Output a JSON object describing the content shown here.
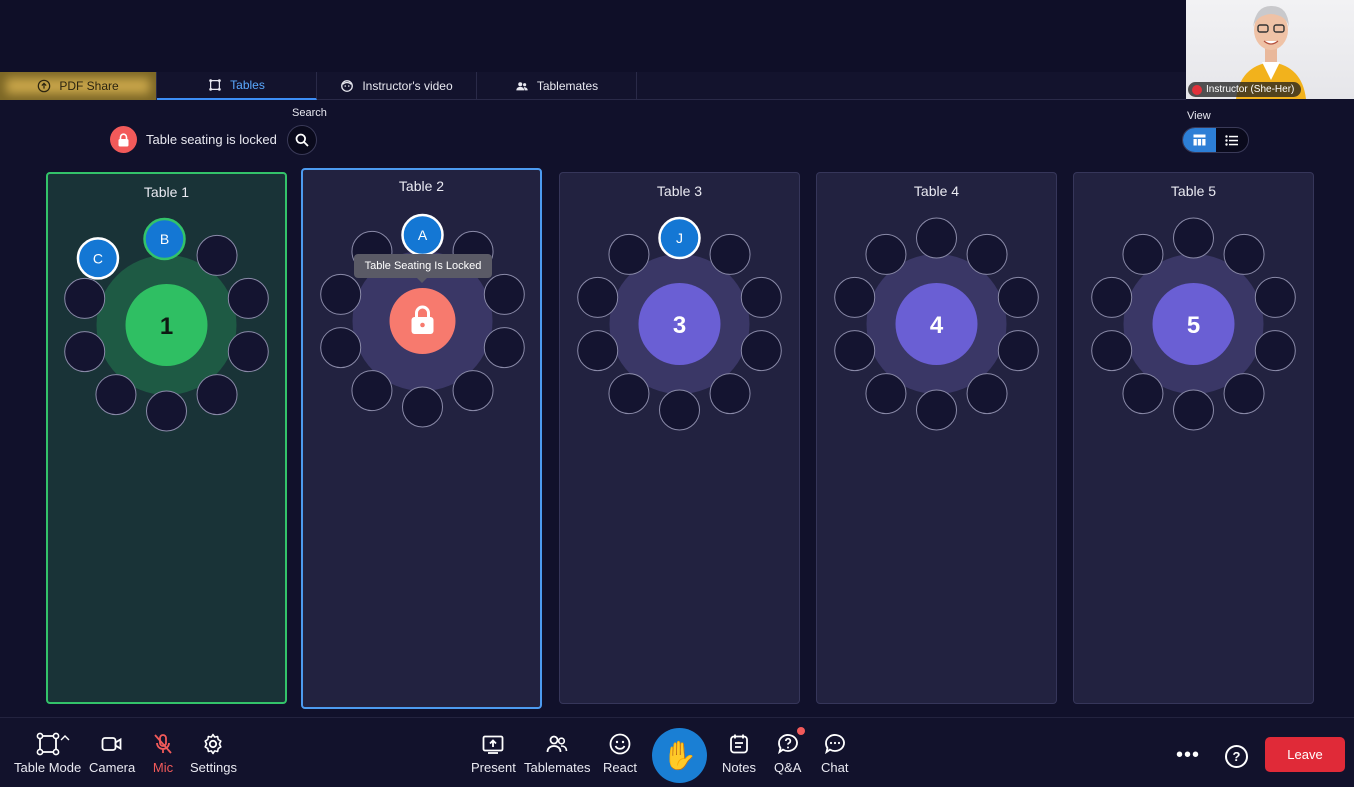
{
  "tabs": [
    {
      "label": "PDF Share",
      "icon": "share-screen-icon"
    },
    {
      "label": "Tables",
      "icon": "tables-icon"
    },
    {
      "label": "Instructor's video",
      "icon": "face-icon"
    },
    {
      "label": "Tablemates",
      "icon": "people-icon"
    }
  ],
  "instructor_video": {
    "label": "Instructor (She-Her)"
  },
  "status": {
    "lock_text": "Table seating is locked",
    "search_label": "Search",
    "view_label": "View"
  },
  "tooltip": "Table Seating Is Locked",
  "tables": [
    {
      "title": "Table 1",
      "number": "1",
      "seats_taken": [
        "C",
        "B"
      ]
    },
    {
      "title": "Table 2",
      "number": "",
      "seats_taken": [
        "A"
      ]
    },
    {
      "title": "Table 3",
      "number": "3",
      "seats_taken": [
        "J"
      ]
    },
    {
      "title": "Table 4",
      "number": "4",
      "seats_taken": []
    },
    {
      "title": "Table 5",
      "number": "5",
      "seats_taken": []
    }
  ],
  "toolbar": {
    "table_mode": "Table Mode",
    "camera": "Camera",
    "mic": "Mic",
    "settings": "Settings",
    "present": "Present",
    "tablemates": "Tablemates",
    "react": "React",
    "notes": "Notes",
    "qa": "Q&A",
    "chat": "Chat",
    "more": "•••",
    "help": "?",
    "leave": "Leave"
  },
  "colors": {
    "accent": "#2d7fd6",
    "green": "#2fbf63",
    "purple": "#6a5fd4",
    "lock": "#f77a6e",
    "leave": "#e02a38"
  }
}
